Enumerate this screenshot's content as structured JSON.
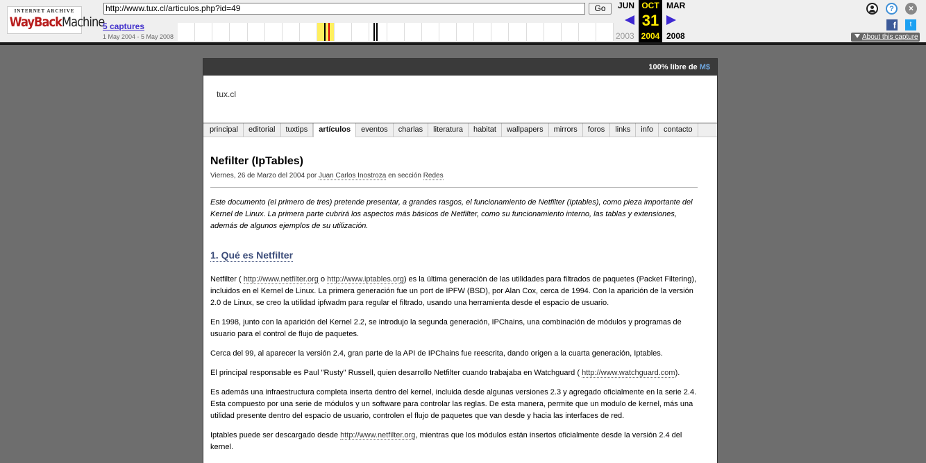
{
  "wayback": {
    "logo_top": "INTERNET ARCHIVE",
    "logo_word1": "WayBack",
    "logo_word2": "Machine",
    "url": "http://www.tux.cl/articulos.php?id=49",
    "go_label": "Go",
    "captures_label": "5 captures",
    "date_range": "1 May 2004 - 5 May 2008",
    "prev_month": "JUN",
    "prev_year": "2003",
    "current_month": "OCT",
    "current_day": "31",
    "current_year": "2004",
    "next_month": "MAR",
    "next_year": "2008",
    "about_label": "About this capture",
    "help_glyph": "?",
    "close_glyph": "×",
    "fb_glyph": "f",
    "tw_glyph": "t"
  },
  "page": {
    "top_tagline": "100% libre de ",
    "top_tagline_ms": "M$",
    "site_title": "tux.cl",
    "nav": [
      {
        "label": "principal"
      },
      {
        "label": "editorial"
      },
      {
        "label": "tuxtips"
      },
      {
        "label": "artículos"
      },
      {
        "label": "eventos"
      },
      {
        "label": "charlas"
      },
      {
        "label": "literatura"
      },
      {
        "label": "habitat"
      },
      {
        "label": "wallpapers"
      },
      {
        "label": "mirrors"
      },
      {
        "label": "foros"
      },
      {
        "label": "links"
      },
      {
        "label": "info"
      },
      {
        "label": "contacto"
      }
    ],
    "active_nav": "artículos",
    "article": {
      "title": "Nefilter (IpTables)",
      "byline_prefix": "Viernes, 26 de Marzo del 2004 por ",
      "author": "Juan Carlos Inostroza",
      "byline_mid": " en sección ",
      "section": "Redes",
      "intro": "Este documento (el primero de tres) pretende presentar, a grandes rasgos, el funcionamiento de Netfilter (Iptables), como pieza importante del Kernel de Linux. La primera parte cubrirá los aspectos más básicos de Netfilter, como su funcionamiento interno, las tablas y extensiones, además de algunos ejemplos de su utilización.",
      "heading1": "1. Qué es Netfilter",
      "p1_a": "Netfilter ( ",
      "p1_link1": "http://www.netfilter.org",
      "p1_b": " o ",
      "p1_link2": "http://www.iptables.org",
      "p1_c": ") es la última generación de las utilidades para filtrados de paquetes (Packet Filtering), incluidos en el Kernel de Linux. La primera generación fue un port de IPFW (BSD), por Alan Cox, cerca de 1994. Con la aparición de la versión 2.0 de Linux, se creo la utilidad ipfwadm para regular el filtrado, usando una herramienta desde el espacio de usuario.",
      "p2": "En 1998, junto con la aparición del Kernel 2.2, se introdujo la segunda generación, IPChains, una combinación de módulos y programas de usuario para el control de flujo de paquetes.",
      "p3": "Cerca del 99, al aparecer la versión 2.4, gran parte de la API de IPChains fue reescrita, dando origen a la cuarta generación, Iptables.",
      "p4_a": "El principal responsable es Paul \"Rusty\" Russell, quien desarrollo Netfilter cuando trabajaba en Watchguard ( ",
      "p4_link": "http://www.watchguard.com",
      "p4_b": ").",
      "p5": "Es además una infraestructura completa inserta dentro del kernel, incluida desde algunas versiones 2.3 y agregado oficialmente en la serie 2.4. Esta compuesto por una serie de módulos y un software para controlar las reglas. De esta manera, permite que un modulo de kernel, más una utilidad presente dentro del espacio de usuario, controlen el flujo de paquetes que van desde y hacia las interfaces de red.",
      "p6_a": "Iptables puede ser descargado desde ",
      "p6_link": "http://www.netfilter.org",
      "p6_b": ", mientras que los módulos están insertos oficialmente desde la versión 2.4 del kernel."
    }
  },
  "colors": {
    "wayback_accent": "#ffea00",
    "arrow": "#3e28d2",
    "heading": "#3c4d7a"
  }
}
